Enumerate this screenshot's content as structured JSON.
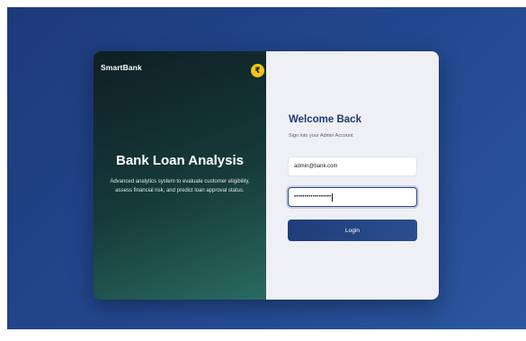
{
  "brand": {
    "name": "SmartBank",
    "coin_symbol": "₹",
    "coin_color": "#f5c518"
  },
  "hero": {
    "title": "Bank Loan Analysis",
    "description": "Advanced analytics system to evaluate customer eligibility, assess financial risk, and predict loan approval status."
  },
  "login": {
    "heading": "Welcome Back",
    "subtitle": "Sign into your Admin Account",
    "email_value": "admin@bank.com",
    "password_value": "••••••••••••••••••",
    "button_label": "Login"
  },
  "colors": {
    "background": "#22458c",
    "accent": "#1f3d78",
    "panel_left": "#163a3a",
    "panel_right": "#eef0f5"
  }
}
